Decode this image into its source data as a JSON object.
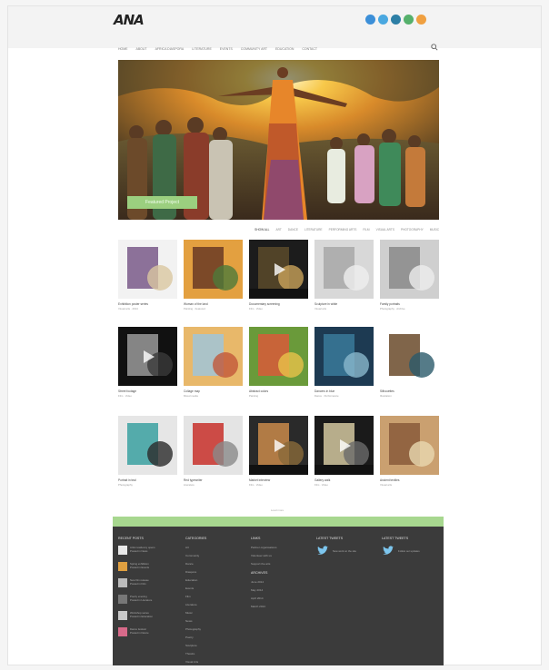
{
  "site": {
    "logo_text": "ANA",
    "brand_color": "#9bcf7f",
    "footer_bg": "#3b3b3b"
  },
  "socials": [
    {
      "icon": "facebook-icon",
      "color": "#3c8fd8"
    },
    {
      "icon": "twitter-icon",
      "color": "#4aa8e0"
    },
    {
      "icon": "vimeo-icon",
      "color": "#2d7fa6"
    },
    {
      "icon": "google-plus-icon",
      "color": "#55b06b"
    },
    {
      "icon": "rss-icon",
      "color": "#f0a040"
    }
  ],
  "nav": {
    "items": [
      "Home",
      "About",
      "Africa Diaspora",
      "Literature",
      "Events",
      "Community Art",
      "Education",
      "Contact"
    ]
  },
  "hero": {
    "caption": "Featured Project"
  },
  "filters": {
    "items": [
      "Show all",
      "Art",
      "Dance",
      "Literature",
      "Performing arts",
      "Film",
      "Visual Arts",
      "Photography",
      "Music"
    ]
  },
  "tiles": [
    {
      "title": "Exhibition poster series",
      "desc": "Visual arts · 2014"
    },
    {
      "title": "Woman of the land",
      "desc": "Painting · Featured"
    },
    {
      "title": "Documentary screening",
      "desc": "Film · Video"
    },
    {
      "title": "Sculpture in white",
      "desc": "Visual arts"
    },
    {
      "title": "Family portraits",
      "desc": "Photography · Archive"
    },
    {
      "title": "Street footage",
      "desc": "Film · Video"
    },
    {
      "title": "Collage map",
      "desc": "Mixed media"
    },
    {
      "title": "Abstract colors",
      "desc": "Painting"
    },
    {
      "title": "Dancers in blue",
      "desc": "Dance · Performance"
    },
    {
      "title": "Silhouettes",
      "desc": "Illustration"
    },
    {
      "title": "Portrait in teal",
      "desc": "Photography"
    },
    {
      "title": "Red typewriter",
      "desc": "Literature"
    },
    {
      "title": "Market interview",
      "desc": "Film · Video"
    },
    {
      "title": "Gallery walk",
      "desc": "Film · Video"
    },
    {
      "title": "Ancient textiles",
      "desc": "Visual arts"
    }
  ],
  "pager": {
    "text": "Load more"
  },
  "footer": {
    "col1": {
      "heading": "Recent posts",
      "posts": [
        {
          "line1": "Artist residency opens",
          "line2": "Posted in News"
        },
        {
          "line1": "Spring exhibition",
          "line2": "Posted in Events"
        },
        {
          "line1": "New film release",
          "line2": "Posted in Film"
        },
        {
          "line1": "Poetry evening",
          "line2": "Posted in Literature"
        },
        {
          "line1": "Workshop series",
          "line2": "Posted in Education"
        },
        {
          "line1": "Dance festival",
          "line2": "Posted in Dance"
        }
      ]
    },
    "col2": {
      "heading": "Categories",
      "links": [
        "Art",
        "Community",
        "Dance",
        "Diaspora",
        "Education",
        "Events",
        "Film",
        "Literature",
        "Music",
        "News",
        "Photography",
        "Poetry",
        "Sculpture",
        "Theatre",
        "Visual Arts"
      ]
    },
    "col3": {
      "heading": "Links",
      "links": [
        "Partner organisations",
        "Volunteer with us",
        "Support the arts"
      ],
      "heading2": "Archives",
      "links2": [
        "June 2014",
        "May 2014",
        "April 2014",
        "March 2014"
      ]
    },
    "col4": {
      "heading": "Latest tweets",
      "tweet": "New work on the site"
    },
    "col5": {
      "heading": "Latest tweets",
      "tweet": "Follow our updates"
    }
  }
}
